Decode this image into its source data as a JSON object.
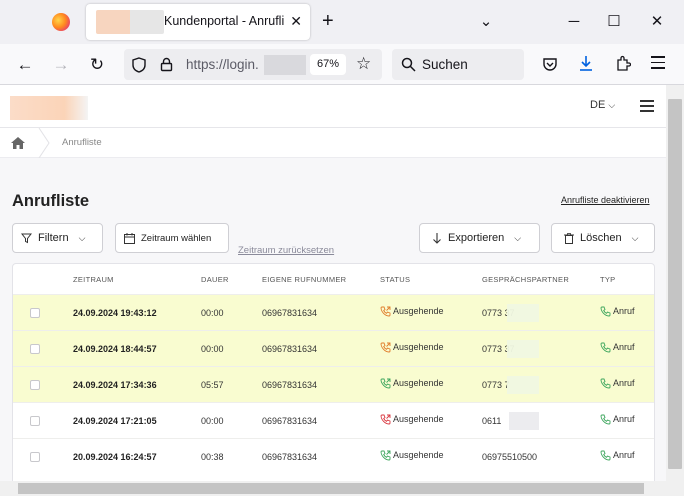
{
  "browser": {
    "tab_title": "Kundenportal - Anrufli",
    "url": "https://login.",
    "zoom": "67%",
    "search_placeholder": "Suchen"
  },
  "header": {
    "language": "DE"
  },
  "breadcrumb": {
    "current": "Anrufliste"
  },
  "page": {
    "title": "Anrufliste",
    "deactivate_link": "Anrufliste deaktivieren"
  },
  "toolbar": {
    "filter_label": "Filtern",
    "date_range_label": "Zeitraum wählen",
    "reset_label": "Zeitraum zurücksetzen",
    "export_label": "Exportieren",
    "delete_label": "Löschen"
  },
  "table": {
    "columns": [
      "ZEITRAUM",
      "DAUER",
      "EIGENE RUFNUMMER",
      "STATUS",
      "GESPRÄCHSPARTNER",
      "TYP"
    ],
    "rows": [
      {
        "time": "24.09.2024 19:43:12",
        "duration": "00:00",
        "own": "06967831634",
        "status": "Ausgehende",
        "partner": "0773          37",
        "type": "Anruf",
        "highlight": true,
        "status_color": "#e07b2a"
      },
      {
        "time": "24.09.2024 18:44:57",
        "duration": "00:00",
        "own": "06967831634",
        "status": "Ausgehende",
        "partner": "0773          37",
        "type": "Anruf",
        "highlight": true,
        "status_color": "#e07b2a"
      },
      {
        "time": "24.09.2024 17:34:36",
        "duration": "05:57",
        "own": "06967831634",
        "status": "Ausgehende",
        "partner": "0773          7",
        "type": "Anruf",
        "highlight": true,
        "status_color": "#3ca55c"
      },
      {
        "time": "24.09.2024 17:21:05",
        "duration": "00:00",
        "own": "06967831634",
        "status": "Ausgehende",
        "partner": "0611",
        "type": "Anruf",
        "highlight": false,
        "status_color": "#d9363e"
      },
      {
        "time": "20.09.2024 16:24:57",
        "duration": "00:38",
        "own": "06967831634",
        "status": "Ausgehende",
        "partner": "06975510500",
        "type": "Anruf",
        "highlight": false,
        "status_color": "#3ca55c"
      }
    ]
  },
  "colors": {
    "highlight_row": "#f9fcd0",
    "type_icon": "#3ca55c"
  }
}
